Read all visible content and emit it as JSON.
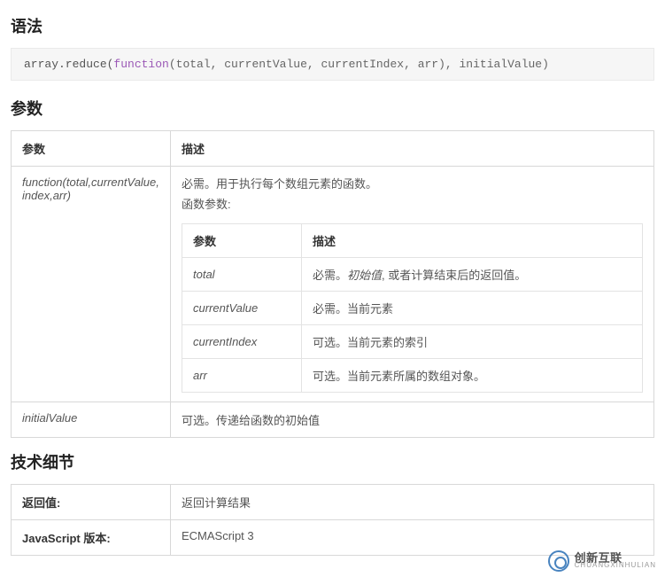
{
  "sections": {
    "syntax_heading": "语法",
    "params_heading": "参数",
    "tech_heading": "技术细节"
  },
  "code": {
    "pre": "array.reduce(",
    "keyword": "function",
    "sig": "(total, currentValue, currentIndex, arr), initialValue)"
  },
  "params_table": {
    "header_param": "参数",
    "header_desc": "描述",
    "rows": [
      {
        "name": "function(total,currentValue, index,arr)",
        "desc_line1": "必需。用于执行每个数组元素的函数。",
        "desc_line2": "函数参数:",
        "inner": {
          "header_param": "参数",
          "header_desc": "描述",
          "rows": [
            {
              "name": "total",
              "desc_prefix": "必需。",
              "desc_italic": "初始值",
              "desc_suffix": ", 或者计算结束后的返回值。"
            },
            {
              "name": "currentValue",
              "desc": "必需。当前元素"
            },
            {
              "name": "currentIndex",
              "desc": "可选。当前元素的索引"
            },
            {
              "name": "arr",
              "desc": "可选。当前元素所属的数组对象。"
            }
          ]
        }
      },
      {
        "name": "initialValue",
        "desc": "可选。传递给函数的初始值"
      }
    ]
  },
  "tech_table": {
    "rows": [
      {
        "label": "返回值:",
        "value": "返回计算结果"
      },
      {
        "label": "JavaScript 版本:",
        "value": "ECMAScript 3"
      }
    ]
  },
  "watermark": {
    "text": "创新互联",
    "sub": "CHUANGXINHULIAN"
  }
}
